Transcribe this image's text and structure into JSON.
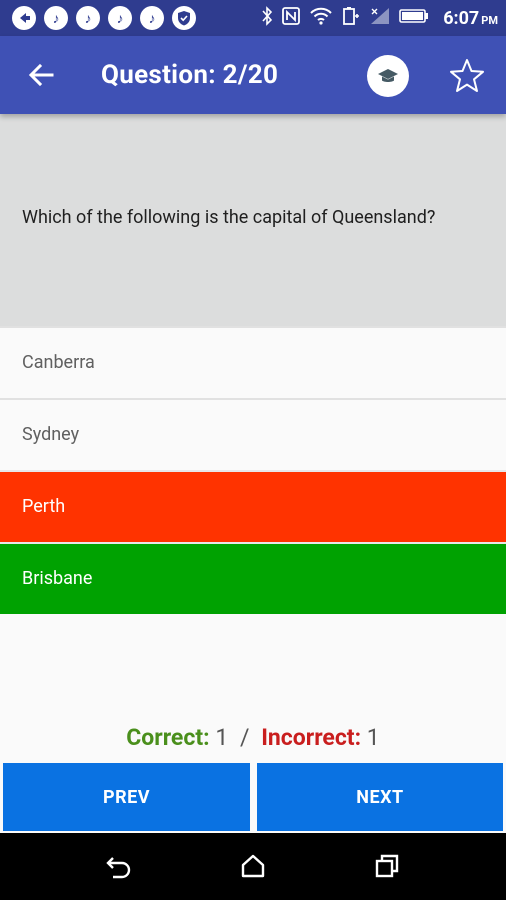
{
  "status_bar": {
    "time": "6:07",
    "ampm": "PM",
    "left_icons": [
      "back-icon",
      "music-icon",
      "music-icon",
      "music-icon",
      "music-icon",
      "shield-icon"
    ],
    "right_icons": [
      "bluetooth-icon",
      "nfc-icon",
      "wifi-icon",
      "battery-saver-icon",
      "signal-icon",
      "battery-icon"
    ]
  },
  "app_bar": {
    "title": "Question: 2/20",
    "back_icon": "arrow-left-icon",
    "cap_icon": "graduation-cap-icon",
    "star_icon": "star-outline-icon"
  },
  "question": {
    "text": "Which of the following is the capital of Queensland?"
  },
  "options": [
    {
      "label": "Canberra",
      "state": "neutral"
    },
    {
      "label": "Sydney",
      "state": "neutral"
    },
    {
      "label": "Perth",
      "state": "wrong"
    },
    {
      "label": "Brisbane",
      "state": "correct"
    }
  ],
  "score": {
    "correct_label": "Correct:",
    "correct_count": "1",
    "separator": "/",
    "incorrect_label": "Incorrect:",
    "incorrect_count": "1"
  },
  "buttons": {
    "prev": "PREV",
    "next": "NEXT"
  },
  "colors": {
    "app_bar": "#3f51b5",
    "status_bar": "#2f3c8f",
    "wrong": "#ff3300",
    "correct": "#00a201",
    "button": "#0a72e2",
    "correct_label": "#4a8f1c",
    "incorrect_label": "#c91e1e"
  }
}
